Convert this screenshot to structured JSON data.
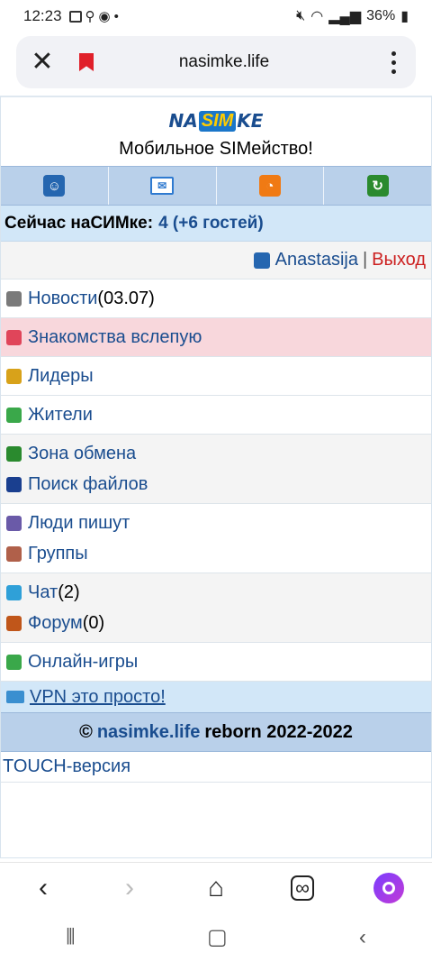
{
  "status": {
    "time": "12:23",
    "dot": "•",
    "battery": "36%"
  },
  "browser": {
    "close_icon": "close-icon",
    "url": "nasimke.life"
  },
  "site": {
    "logo": {
      "left": "NA",
      "mid": "SIM",
      "right": "KE"
    },
    "slogan": "Мобильное SIMейство!",
    "online_label": "Сейчас наСИМке:",
    "online_count": "4 (+6 гостей)",
    "user_name": "Anastasija",
    "separator": "|",
    "logout": "Выход"
  },
  "menu": {
    "news": {
      "label": "Новости",
      "extra": "(03.07)"
    },
    "dating": {
      "label": "Знакомства вслепую"
    },
    "leaders": {
      "label": "Лидеры"
    },
    "residents": {
      "label": "Жители"
    },
    "exchange": {
      "label": "Зона обмена"
    },
    "search": {
      "label": "Поиск файлов"
    },
    "people": {
      "label": "Люди пишут"
    },
    "groups": {
      "label": "Группы"
    },
    "chat": {
      "label": "Чат",
      "extra": "(2)"
    },
    "forum": {
      "label": "Форум",
      "extra": "(0)"
    },
    "games": {
      "label": "Онлайн-игры"
    }
  },
  "vpn": {
    "label": "VPN это просто!"
  },
  "footer": {
    "copy": "©",
    "site": "nasimke.life",
    "text": "reborn 2022-2022"
  },
  "touch": {
    "label": "TOUCH-версия"
  },
  "colors": {
    "link": "#1a4d8f",
    "logout": "#cc1f1f",
    "bar": "#b9d0ea",
    "online_bg": "#d2e7f8",
    "pink": "#f8d7dc"
  }
}
